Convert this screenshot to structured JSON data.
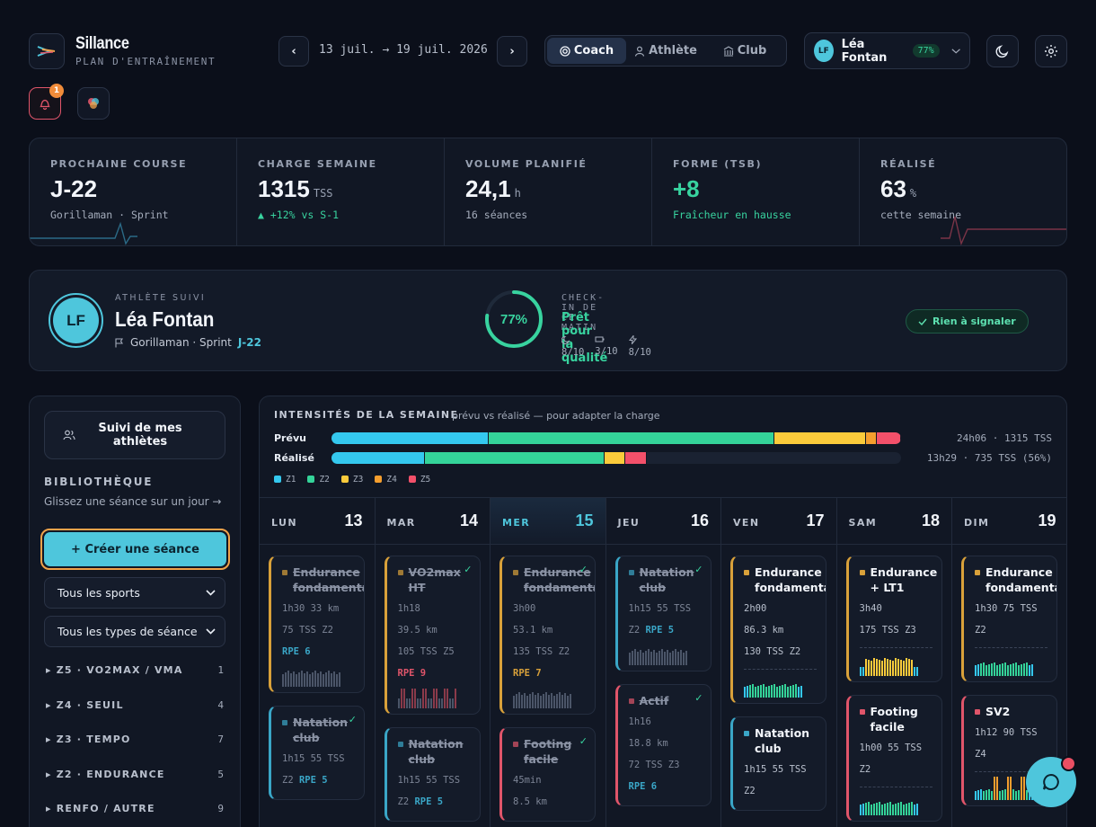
{
  "brand": {
    "name": "Sillance",
    "subtitle": "PLAN D'ENTRAÎNEMENT"
  },
  "week": {
    "range": "13 juil. → 19 juil. 2026",
    "prev": "‹",
    "next": "›"
  },
  "modes": [
    {
      "label": "Coach",
      "icon": "target-icon",
      "active": true
    },
    {
      "label": "Athlète",
      "icon": "person-icon",
      "active": false
    },
    {
      "label": "Club",
      "icon": "building-icon",
      "active": false
    }
  ],
  "user": {
    "initials": "LF",
    "name": "Léa Fontan",
    "readiness": "77%"
  },
  "notifications": {
    "count": "1"
  },
  "stats": [
    {
      "label": "PROCHAINE COURSE",
      "value": "J-22",
      "unit": "",
      "sub": "Gorillaman · Sprint",
      "accent": "#4ec6dc"
    },
    {
      "label": "CHARGE SEMAINE",
      "value": "1315",
      "unit": "TSS",
      "sub": "▲ +12% vs S-1"
    },
    {
      "label": "VOLUME PLANIFIÉ",
      "value": "24,1",
      "unit": "h",
      "sub": "16 séances"
    },
    {
      "label": "FORME (TSB)",
      "value": "+8",
      "unit": "",
      "sub": "Fraîcheur en hausse"
    },
    {
      "label": "RÉALISÉ",
      "value": "63",
      "unit": "%",
      "sub": "cette semaine",
      "accent": "#e0556a"
    }
  ],
  "athlete": {
    "label": "ATHLÈTE SUIVI",
    "initials": "LF",
    "name": "Léa Fontan",
    "race": "Gorillaman · Sprint",
    "countdown": "J-22",
    "checkin": {
      "label": "CHECK-IN DE CE MATIN",
      "score": "77%",
      "score_value": 0.77,
      "status": "Prêt pour la qualité",
      "sleep": "8/10",
      "energy": "3/10",
      "fatigue": "8/10"
    },
    "flag": "Rien à signaler"
  },
  "sidebar": {
    "suivi": "Suivi de mes athlètes",
    "library_title": "BIBLIOTHÈQUE",
    "library_sub": "Glissez une séance sur un jour →",
    "create": "+ Créer une séance",
    "sport_filter": "Tous les sports",
    "type_filter": "Tous les types de séance",
    "categories": [
      {
        "label": "Z5 · VO2MAX / VMA",
        "count": "1"
      },
      {
        "label": "Z4 · SEUIL",
        "count": "4"
      },
      {
        "label": "Z3 · TEMPO",
        "count": "7"
      },
      {
        "label": "Z2 · ENDURANCE",
        "count": "5"
      },
      {
        "label": "RENFO / AUTRE",
        "count": "9"
      }
    ]
  },
  "intensities": {
    "title": "INTENSITÉS DE LA SEMAINE",
    "subtitle": "prévu vs réalisé — pour adapter la charge",
    "planned": {
      "label": "Prévu",
      "stat": "24h06 · 1315 TSS",
      "shares": [
        27.6,
        50.2,
        16.1,
        1.8,
        4.3
      ]
    },
    "done": {
      "label": "Réalisé",
      "stat": "13h29 · 735 TSS (56%)",
      "shares": [
        16.4,
        31.6,
        3.5,
        0,
        3.9
      ]
    },
    "zones": [
      {
        "name": "Z1",
        "color": "#34c8ee"
      },
      {
        "name": "Z2",
        "color": "#34d399"
      },
      {
        "name": "Z3",
        "color": "#fbcb3b"
      },
      {
        "name": "Z4",
        "color": "#f59e2e"
      },
      {
        "name": "Z5",
        "color": "#f3506a"
      }
    ]
  },
  "days": [
    {
      "name": "LUN",
      "num": "13",
      "today": false
    },
    {
      "name": "MAR",
      "num": "14",
      "today": false
    },
    {
      "name": "MER",
      "num": "15",
      "today": true
    },
    {
      "name": "JEU",
      "num": "16",
      "today": false
    },
    {
      "name": "VEN",
      "num": "17",
      "today": false
    },
    {
      "name": "SAM",
      "num": "18",
      "today": false
    },
    {
      "name": "DIM",
      "num": "19",
      "today": false
    }
  ],
  "sessions": [
    [
      {
        "title": "Endurance\nfondamentale",
        "sport": "run",
        "color": "#d9a13a",
        "done": true,
        "lines": [
          "1h30  33 km",
          "75 TSS  Z2"
        ],
        "rpe": "RPE 6",
        "rpe_color": "#3aa6c7",
        "check": false,
        "bars": "run-easy"
      },
      {
        "title": "Natation\nclub",
        "sport": "swim",
        "color": "#3aa6c7",
        "done": true,
        "lines": [
          "1h15  55 TSS",
          "Z2  RPE 5"
        ],
        "rpe": "",
        "check": true
      }
    ],
    [
      {
        "title": "VO2max\nHT",
        "sport": "run",
        "color": "#d9a13a",
        "done": true,
        "lines": [
          "1h18",
          "39.5 km",
          "105 TSS  Z5"
        ],
        "rpe": "RPE 9",
        "rpe_color": "#e0556a",
        "check": true,
        "bars": "vo2"
      },
      {
        "title": "Natation\nclub",
        "sport": "swim",
        "color": "#3aa6c7",
        "done": true,
        "lines": [
          "1h15  55 TSS",
          "Z2  RPE 5"
        ],
        "rpe": "",
        "check": false
      }
    ],
    [
      {
        "title": "Endurance\nfondamentale",
        "sport": "run",
        "color": "#d9a13a",
        "done": true,
        "lines": [
          "3h00",
          "53.1 km",
          "135 TSS  Z2"
        ],
        "rpe": "RPE 7",
        "rpe_color": "#d9a13a",
        "check": true,
        "bars": "run-easy"
      },
      {
        "title": "Footing\nfacile",
        "sport": "run",
        "color": "#e0556a",
        "done": true,
        "lines": [
          "45min",
          "8.5 km"
        ],
        "rpe": "",
        "check": true
      }
    ],
    [
      {
        "title": "Natation\nclub",
        "sport": "swim",
        "color": "#3aa6c7",
        "done": true,
        "lines": [
          "1h15  55 TSS",
          "Z2  RPE 5"
        ],
        "rpe": "",
        "check": true,
        "bars": "run-easy"
      },
      {
        "title": "Actif",
        "sport": "run",
        "color": "#e0556a",
        "done": true,
        "lines": [
          "1h16",
          "18.8 km",
          "72 TSS  Z3"
        ],
        "rpe": "RPE 6",
        "rpe_color": "#3aa6c7",
        "check": true
      }
    ],
    [
      {
        "title": "Endurance\nfondamentale",
        "sport": "bike",
        "color": "#d9a13a",
        "done": false,
        "lines": [
          "2h00",
          "86.3 km",
          "130 TSS  Z2"
        ],
        "rpe": "",
        "check": false,
        "bars": "green"
      },
      {
        "title": "Natation\nclub",
        "sport": "swim",
        "color": "#3aa6c7",
        "done": false,
        "lines": [
          "1h15  55 TSS",
          "Z2"
        ],
        "rpe": "",
        "check": false
      }
    ],
    [
      {
        "title": "Endurance\n+ LT1",
        "sport": "bike",
        "color": "#d9a13a",
        "done": false,
        "lines": [
          "3h40",
          "175 TSS  Z3"
        ],
        "rpe": "",
        "check": false,
        "bars": "yellow"
      },
      {
        "title": "Footing\nfacile",
        "sport": "run",
        "color": "#e0556a",
        "done": false,
        "lines": [
          "1h00  55 TSS",
          "Z2"
        ],
        "rpe": "",
        "check": false,
        "bars": "green"
      }
    ],
    [
      {
        "title": "Endurance\nfondamentale",
        "sport": "bike",
        "color": "#d9a13a",
        "done": false,
        "lines": [
          "1h30  75 TSS",
          "Z2"
        ],
        "rpe": "",
        "check": false,
        "bars": "green"
      },
      {
        "title": "SV2",
        "sport": "run",
        "color": "#e0556a",
        "done": false,
        "lines": [
          "1h12  90 TSS",
          "Z4"
        ],
        "rpe": "",
        "check": false,
        "bars": "sv2"
      }
    ]
  ]
}
